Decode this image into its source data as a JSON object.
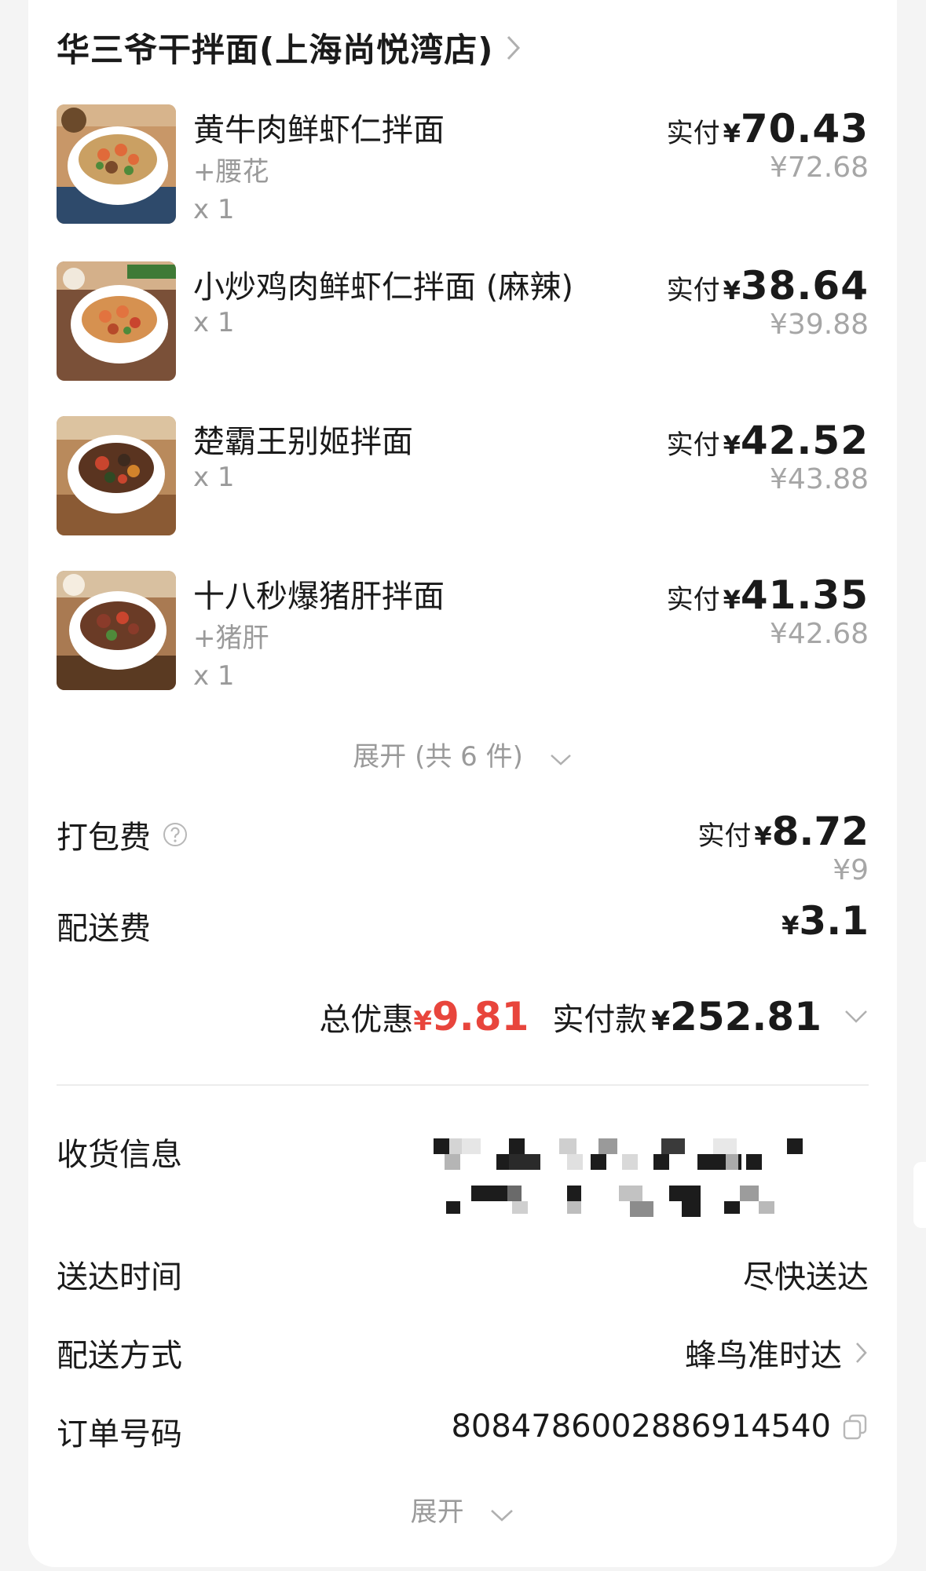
{
  "shop": {
    "name": "华三爷干拌面(上海尚悦湾店)"
  },
  "labels": {
    "paid": "实付",
    "yen": "¥"
  },
  "items": [
    {
      "name": "黄牛肉鲜虾仁拌面",
      "addon": "+腰花",
      "qty": "x 1",
      "paid": "70.43",
      "original": "¥72.68"
    },
    {
      "name": "小炒鸡肉鲜虾仁拌面 (麻辣)",
      "addon": "",
      "qty": "x 1",
      "paid": "38.64",
      "original": "¥39.88"
    },
    {
      "name": "楚霸王别姬拌面",
      "addon": "",
      "qty": "x 1",
      "paid": "42.52",
      "original": "¥43.88"
    },
    {
      "name": "十八秒爆猪肝拌面",
      "addon": "+猪肝",
      "qty": "x 1",
      "paid": "41.35",
      "original": "¥42.68"
    }
  ],
  "expand_items": {
    "label": "展开 (共 6 件)"
  },
  "fees": {
    "packing": {
      "label": "打包费",
      "paid": "8.72",
      "original": "¥9"
    },
    "delivery": {
      "label": "配送费",
      "amount": "3.1"
    }
  },
  "summary": {
    "discount_label": "总优惠",
    "discount_amount": "9.81",
    "total_label": "实付款",
    "total_amount": "252.81"
  },
  "info": {
    "address_label": "收货信息",
    "time_label": "送达时间",
    "time_value": "尽快送达",
    "method_label": "配送方式",
    "method_value": "蜂鸟准时达",
    "order_label": "订单号码",
    "order_value": "8084786002886914540"
  },
  "expand_more": {
    "label": "展开"
  },
  "colors": {
    "accent_red": "#e8453c",
    "muted": "#9a9a9a",
    "background": "#f4f4f4"
  },
  "icons": [
    "chevron-right-icon",
    "chevron-down-icon",
    "help-circle-icon",
    "copy-icon"
  ]
}
